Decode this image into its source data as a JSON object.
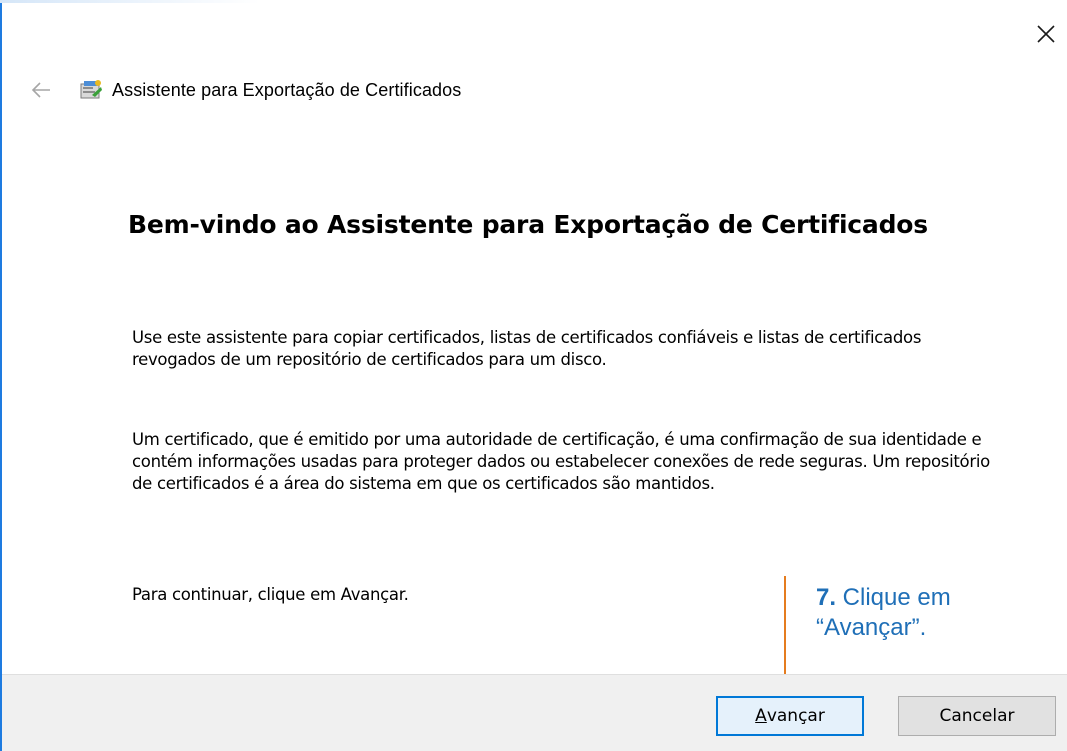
{
  "window": {
    "title": "Assistente para Exportação de Certificados",
    "close_symbol": "×"
  },
  "page": {
    "heading": "Bem-vindo ao Assistente para Exportação de Certificados",
    "paragraphs": [
      "Use este assistente para copiar certificados, listas de certificados confiáveis e listas de certificados revogados de um repositório de certificados para um disco.",
      "Um certificado, que é emitido por uma autoridade de certificação, é uma confirmação de sua identidade e contém informações usadas para proteger dados ou estabelecer conexões de rede seguras. Um repositório de certificados é a área do sistema em que os certificados são mantidos.",
      "Para continuar, clique em Avançar."
    ]
  },
  "buttons": {
    "next_mnemonic": "A",
    "next_rest": "vançar",
    "cancel": "Cancelar"
  },
  "annotation": {
    "step": "7.",
    "text_line1": " Clique em",
    "text_line2": "“Avançar”."
  },
  "icons": {
    "back": "back-arrow-icon",
    "app": "certificate-wizard-icon",
    "close": "close-icon"
  },
  "colors": {
    "accent": "#0078d7",
    "window_border": "#1e7be0",
    "callout_line": "#e57c1f",
    "callout_text": "#1f6fb7",
    "footer_bg": "#f0f0f0"
  }
}
